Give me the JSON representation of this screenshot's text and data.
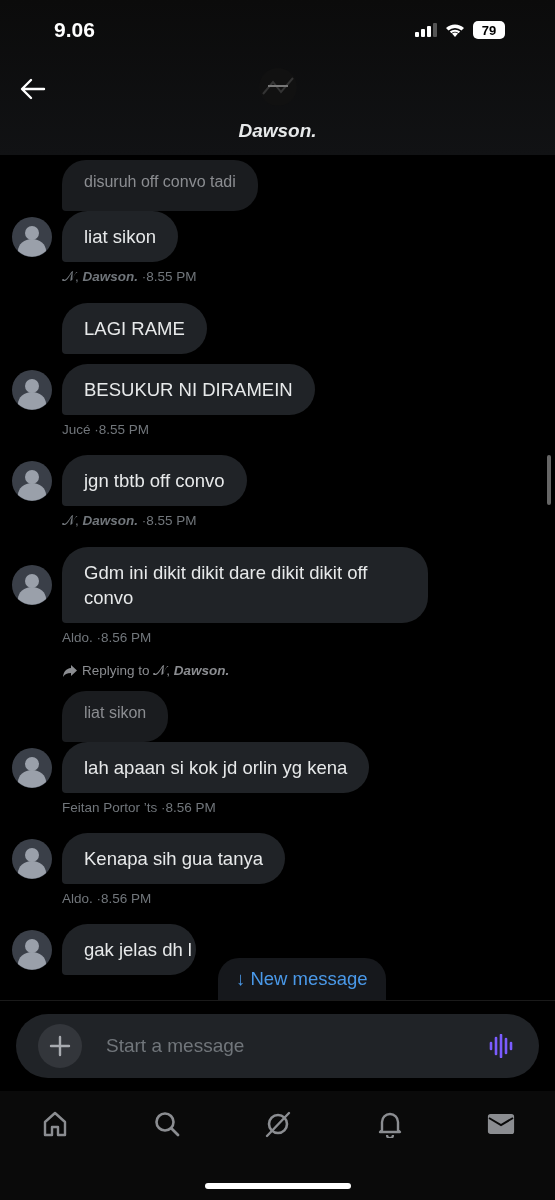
{
  "status_bar": {
    "time": "9.06",
    "battery": "79"
  },
  "header": {
    "title": "Dawson."
  },
  "messages": [
    {
      "quote": "disuruh off convo tadi",
      "bubbles": [
        "liat sikon"
      ],
      "meta": "𝒩, **Dawson.** ·8.55 PM"
    },
    {
      "bubbles": [
        "LAGI RAME",
        "BESUKUR NI DIRAMEIN"
      ],
      "meta": "Jucé ·8.55 PM"
    },
    {
      "bubbles": [
        "jgn tbtb off convo"
      ],
      "meta": "𝒩, **Dawson.** ·8.55 PM"
    },
    {
      "bubbles": [
        "Gdm ini dikit dikit dare dikit dikit off convo"
      ],
      "meta": "Aldo. ·8.56 PM"
    },
    {
      "reply": "Replying to 𝒩, **Dawson.**",
      "quote": "liat sikon",
      "bubbles": [
        "lah apaan si kok jd orlin yg kena"
      ],
      "meta": "Feitan Portor ’ts ·8.56 PM"
    },
    {
      "bubbles": [
        "Kenapa sih gua tanya"
      ],
      "meta": "Aldo. ·8.56 PM"
    },
    {
      "bubbles": [
        "gak jelas dh l"
      ]
    }
  ],
  "new_message": "↓ New message",
  "composer": {
    "placeholder": "Start a message"
  },
  "tabs": [
    {
      "kind": "home",
      "selected": false
    },
    {
      "kind": "search",
      "selected": false
    },
    {
      "kind": "grok",
      "selected": false
    },
    {
      "kind": "bell",
      "selected": false
    },
    {
      "kind": "mail",
      "selected": true
    }
  ]
}
